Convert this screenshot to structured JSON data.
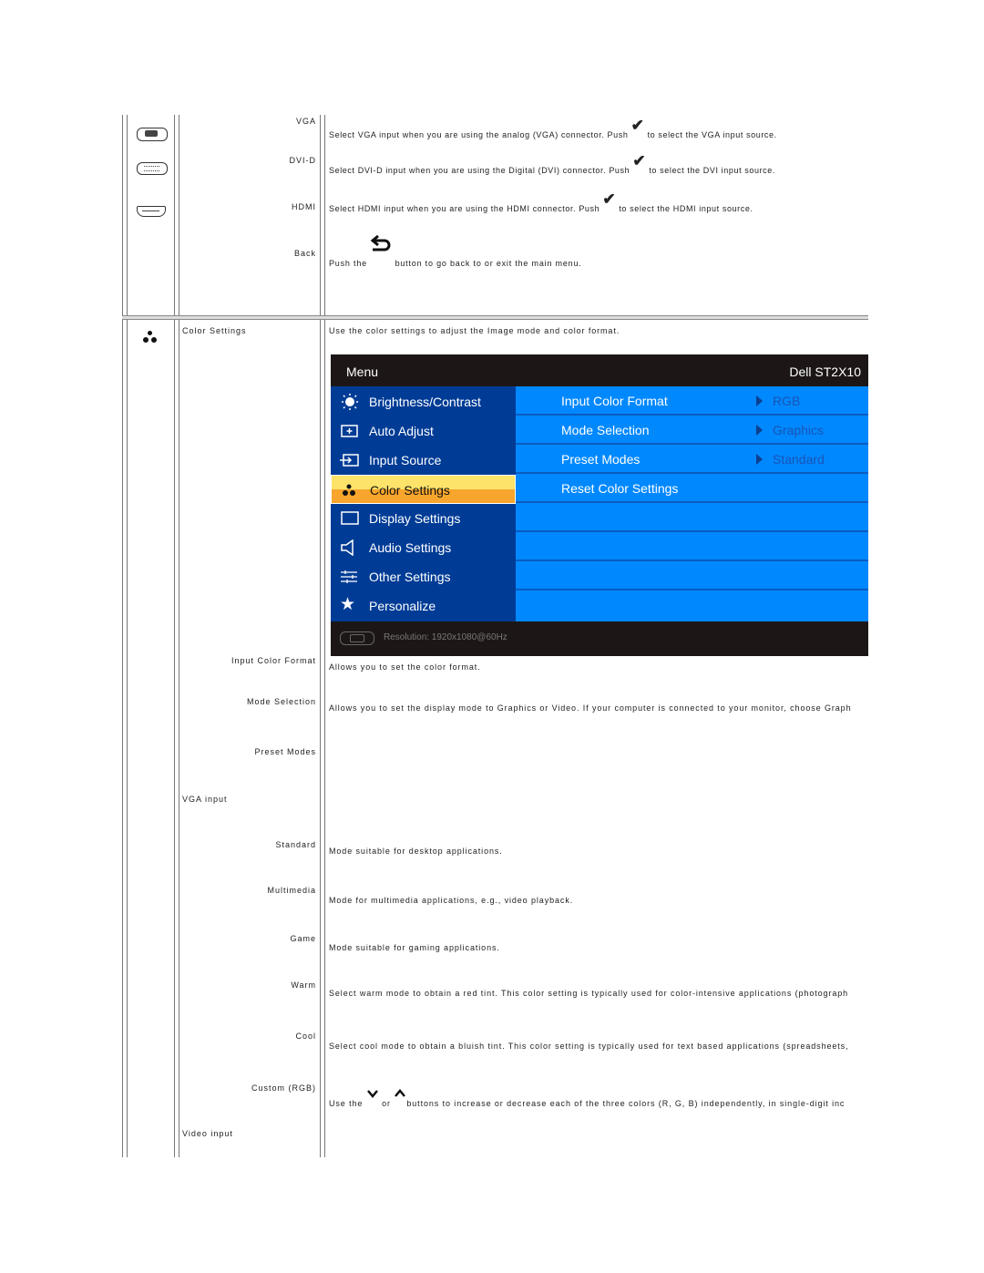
{
  "input_source_section": {
    "rows": [
      {
        "label": "VGA",
        "icon": "vga-connector-icon",
        "description_before": "Select VGA input when you are using the analog (VGA) connector. Push",
        "button_icon": "checkmark-icon",
        "description_after": "to select the VGA input source."
      },
      {
        "label": "DVI-D",
        "icon": "dvi-connector-icon",
        "description_before": "Select DVI-D input when you are using the Digital (DVI) connector. Push",
        "button_icon": "checkmark-icon",
        "description_after": "to select the DVI input source."
      },
      {
        "label": "HDMI",
        "icon": "hdmi-connector-icon",
        "description_before": "Select HDMI input when you are using the HDMI connector. Push",
        "button_icon": "checkmark-icon",
        "description_after": "to select the HDMI input source."
      },
      {
        "label": "Back",
        "description_before": "Push the",
        "button_icon": "back-arrow-icon",
        "description_after": "button  to go back to or exit the main menu."
      }
    ]
  },
  "color_settings_section": {
    "title": "Color Settings",
    "icon": "color-settings-icon",
    "intro": "Use the color settings to adjust the Image mode and color format.",
    "osd": {
      "header_left": "Menu",
      "header_right": "Dell ST2X10",
      "left_menu": [
        {
          "label": "Brightness/Contrast",
          "icon": "brightness-icon"
        },
        {
          "label": "Auto Adjust",
          "icon": "auto-adjust-icon"
        },
        {
          "label": "Input Source",
          "icon": "input-source-icon"
        },
        {
          "label": "Color Settings",
          "icon": "color-settings-icon",
          "selected": true
        },
        {
          "label": "Display Settings",
          "icon": "display-icon"
        },
        {
          "label": "Audio Settings",
          "icon": "speaker-icon"
        },
        {
          "label": "Other Settings",
          "icon": "sliders-icon"
        },
        {
          "label": "Personalize",
          "icon": "star-icon"
        }
      ],
      "right_menu": [
        {
          "label": "Input Color Format",
          "value": "RGB"
        },
        {
          "label": "Mode Selection",
          "value": "Graphics"
        },
        {
          "label": "Preset Modes",
          "value": "Standard"
        },
        {
          "label": "Reset Color Settings",
          "value": ""
        }
      ],
      "footer": "Resolution:  1920x1080@60Hz"
    },
    "items": [
      {
        "label": "Input Color Format",
        "description": "Allows you to set the color format."
      },
      {
        "label": "Mode Selection",
        "description": "Allows you to set the display mode to Graphics or Video. If your computer is connected to your monitor, choose Graph"
      },
      {
        "label": "Preset Modes",
        "description": ""
      },
      {
        "label": "VGA input",
        "description": ""
      },
      {
        "label": "Standard",
        "description": "Mode suitable for desktop applications."
      },
      {
        "label": "Multimedia",
        "description": "Mode for multimedia applications, e.g., video playback."
      },
      {
        "label": "Game",
        "description": "Mode suitable for gaming applications."
      },
      {
        "label": "Warm",
        "description": "Select warm mode to obtain a red tint. This color setting is typically used for color-intensive applications (photograph"
      },
      {
        "label": "Cool",
        "description": "Select cool mode to obtain a bluish tint. This color setting is typically used for text based applications (spreadsheets,"
      },
      {
        "label": "Custom (RGB)",
        "description_before": "Use the",
        "mid": "or",
        "description_after": "buttons to increase or decrease each of the three colors (R, G, B) independently, in single-digit inc"
      },
      {
        "label": "Video input",
        "description": ""
      }
    ]
  }
}
